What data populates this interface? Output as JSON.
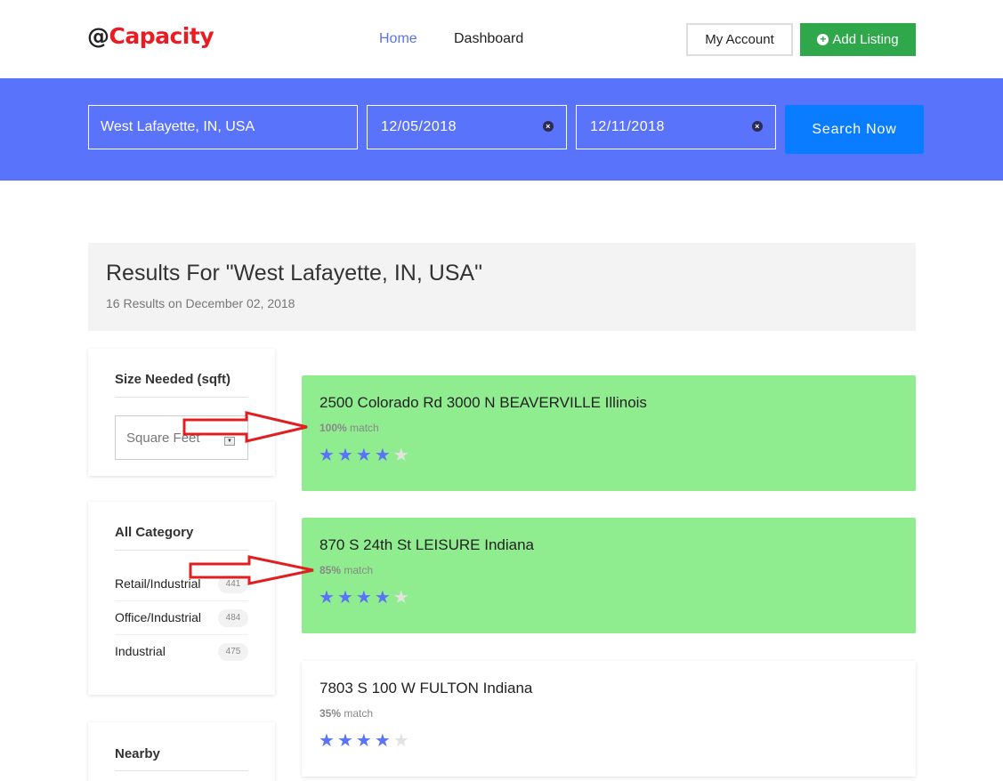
{
  "header": {
    "logo_at": "@",
    "logo_name": "Capacity",
    "nav": [
      {
        "label": "Home",
        "active": true
      },
      {
        "label": "Dashboard",
        "active": false
      }
    ],
    "my_account_label": "My Account",
    "add_listing_label": "Add Listing"
  },
  "search": {
    "location_value": "West Lafayette, IN, USA",
    "start_date": "12/05/2018",
    "end_date": "12/11/2018",
    "button_label": "Search Now"
  },
  "results": {
    "title": "Results For \"West Lafayette, IN, USA\"",
    "subtitle": "16 Results on December 02, 2018"
  },
  "sidebar": {
    "size": {
      "heading": "Size Needed (sqft)",
      "placeholder": "Square Feet"
    },
    "category": {
      "heading": "All Category",
      "items": [
        {
          "label": "Retail/Industrial",
          "count": "441"
        },
        {
          "label": "Office/Industrial",
          "count": "484"
        },
        {
          "label": "Industrial",
          "count": "475"
        }
      ]
    },
    "nearby": {
      "heading": "Nearby"
    }
  },
  "listings": [
    {
      "title": "2500 Colorado Rd 3000 N BEAVERVILLE Illinois",
      "match_pct": "100%",
      "match_word": "match",
      "rating": 4,
      "max_rating": 5,
      "highlight": true
    },
    {
      "title": "870 S 24th St LEISURE Indiana",
      "match_pct": "85%",
      "match_word": "match",
      "rating": 4,
      "max_rating": 5,
      "highlight": true
    },
    {
      "title": "7803 S 100 W FULTON Indiana",
      "match_pct": "35%",
      "match_word": "match",
      "rating": 4,
      "max_rating": 5,
      "highlight": false
    }
  ],
  "colors": {
    "brand_red": "#ea1c23",
    "band_blue": "#5a73fb",
    "search_button": "#0a7cff",
    "add_listing_green": "#2ea84a",
    "highlight_green": "#8fed8f",
    "star_on": "#5a73fb",
    "annotation_arrow": "#e02020"
  },
  "icons": {
    "add_listing": "plus-circle-icon",
    "date_clear": "close-circle-icon",
    "select_caret": "caret-down-icon",
    "rating": "star-icon",
    "annotation": "red-arrow-icon"
  }
}
